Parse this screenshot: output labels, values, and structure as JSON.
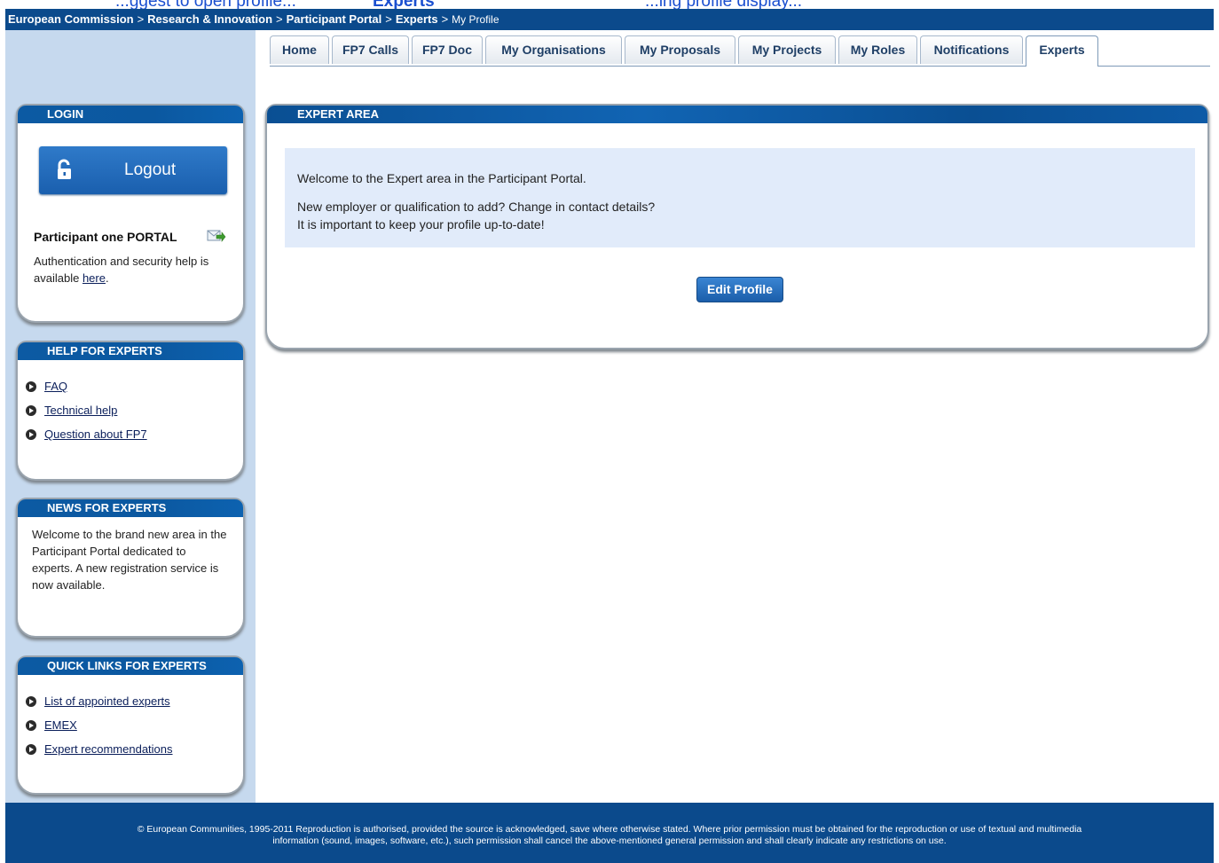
{
  "clipped_header": {
    "left": "...ggest to open profile...",
    "bold": "Experts",
    "right": "...ing profile display..."
  },
  "breadcrumb": {
    "items": [
      "European Commission",
      "Research & Innovation",
      "Participant Portal",
      "Experts"
    ],
    "current": "My Profile",
    "separator": ">"
  },
  "tabs": [
    "Home",
    "FP7 Calls",
    "FP7 Doc",
    "My Organisations",
    "My Proposals",
    "My Projects",
    "My Roles",
    "Notifications",
    "Experts"
  ],
  "active_tab": "Experts",
  "login": {
    "title": "LOGIN",
    "logout_label": "Logout",
    "portal_name": "Participant one PORTAL",
    "help_text": "Authentication and security help is available",
    "help_link": "here",
    "help_suffix": "."
  },
  "help": {
    "title": "HELP FOR EXPERTS",
    "links": [
      "FAQ",
      "Technical help",
      "Question about FP7"
    ]
  },
  "news": {
    "title": "NEWS FOR EXPERTS",
    "text": "Welcome to the brand new area in the Participant Portal dedicated to experts. A new registration service is now available."
  },
  "quick_links": {
    "title": "QUICK LINKS FOR EXPERTS",
    "links": [
      "List of appointed experts",
      "EMEX",
      "Expert recommendations"
    ]
  },
  "expert_area": {
    "title": "EXPERT AREA",
    "line1": "Welcome to the Expert area in the Participant Portal.",
    "line2": "New employer or qualification to add? Change in contact details?",
    "line3": "It is important to keep your profile up-to-date!",
    "edit_label": "Edit Profile"
  },
  "footer": {
    "line1": "© European Communities, 1995-2011 Reproduction is authorised, provided the source is acknowledged, save where otherwise stated. Where prior permission must be obtained for the reproduction or use of textual and multimedia",
    "line2": "information (sound, images, software, etc.), such permission shall cancel the above-mentioned general permission and shall clearly indicate any restrictions on use."
  },
  "colors": {
    "header_blue": "#0b4a8c",
    "sidebar_bg": "#c6d9ee",
    "info_bg": "#e1ebfa"
  }
}
